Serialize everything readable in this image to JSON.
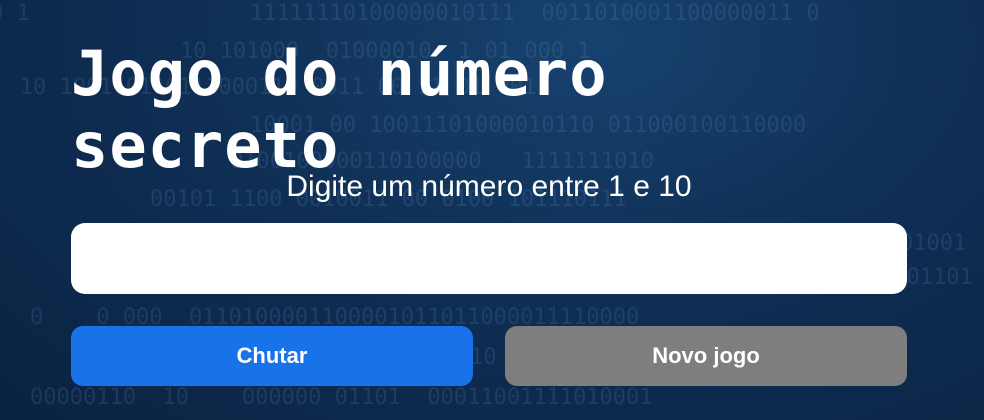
{
  "page": {
    "title": "Jogo do número secreto",
    "subtitle": "Digite um número entre 1 e 10"
  },
  "input": {
    "value": "",
    "placeholder": ""
  },
  "buttons": {
    "guess_label": "Chutar",
    "new_game_label": "Novo jogo"
  },
  "colors": {
    "background": "#0f2f55",
    "primary_button": "#1973e8",
    "secondary_button": "#7e7e7e"
  }
}
